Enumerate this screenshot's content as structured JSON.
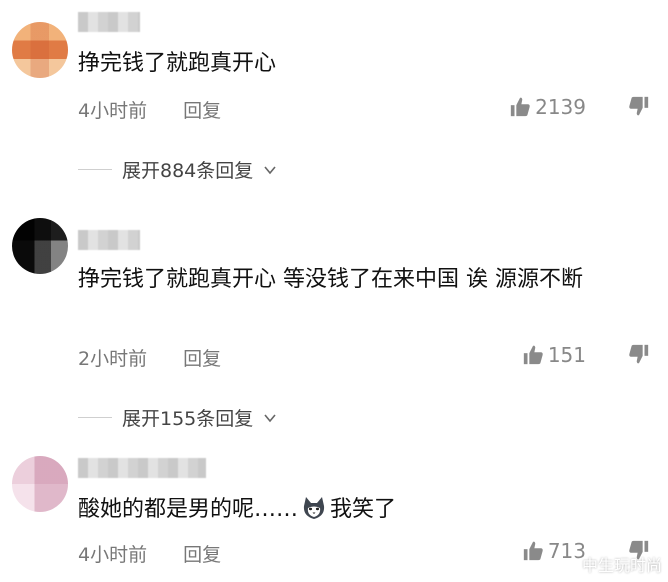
{
  "comments": [
    {
      "username": "██ ██",
      "text": "挣完钱了就跑真开心",
      "time": "4小时前",
      "reply_label": "回复",
      "likes": "2139",
      "expand_label": "展开884条回复"
    },
    {
      "username": "██ ██",
      "text": "挣完钱了就跑真开心 等没钱了在来中国 诶 源源不断",
      "time": "2小时前",
      "reply_label": "回复",
      "likes": "151",
      "expand_label": "展开155条回复"
    },
    {
      "username": "██ ██ ██",
      "text_before": "酸她的都是男的呢……",
      "emoji_icon": "husky-dog-emoji",
      "text_after": "我笑了",
      "time": "4小时前",
      "reply_label": "回复",
      "likes": "713"
    }
  ],
  "watermark": {
    "text": "中生玩时尚",
    "icon": "weibo-logo-icon"
  },
  "colors": {
    "text": "#111111",
    "meta": "#777777",
    "icon": "#888888"
  }
}
